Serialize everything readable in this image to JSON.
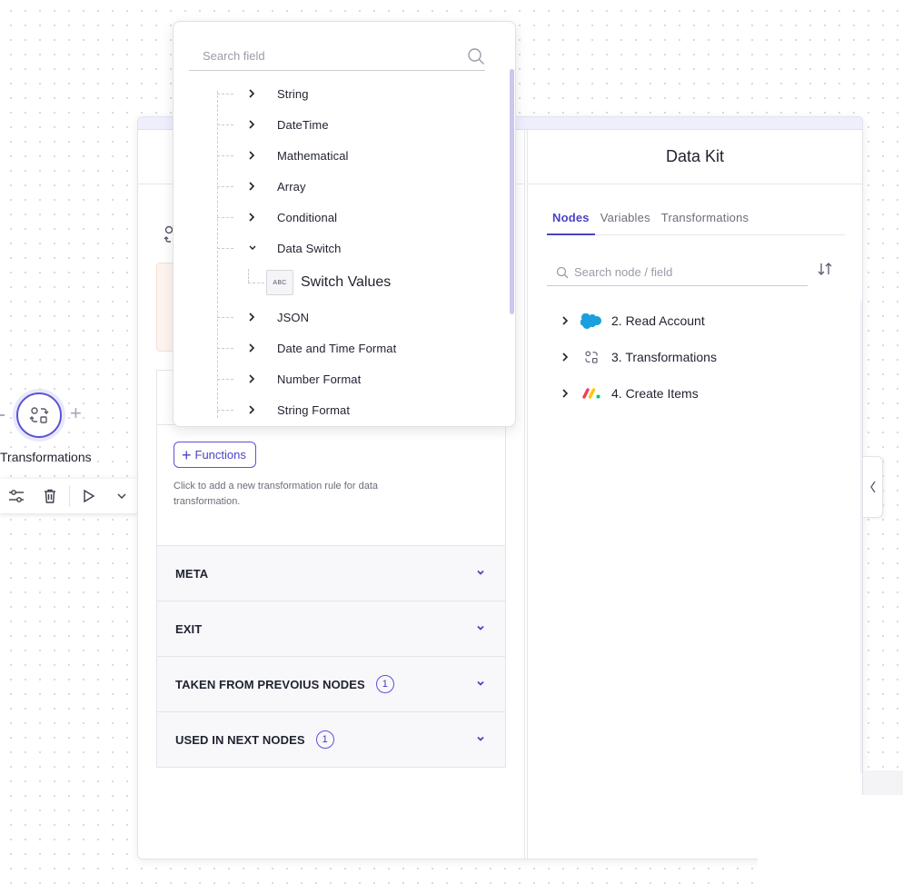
{
  "canvas": {
    "node_label": "Transformations",
    "toolbar_icons": [
      "sliders-icon",
      "trash-icon",
      "play-icon",
      "chevron-down-icon"
    ]
  },
  "functions_dropdown": {
    "search_placeholder": "Search field",
    "categories": [
      {
        "label": "String",
        "expanded": false
      },
      {
        "label": "DateTime",
        "expanded": false
      },
      {
        "label": "Mathematical",
        "expanded": false
      },
      {
        "label": "Array",
        "expanded": false
      },
      {
        "label": "Conditional",
        "expanded": false
      },
      {
        "label": "Data Switch",
        "expanded": true
      },
      {
        "label": "JSON",
        "expanded": false
      },
      {
        "label": "Date and Time Format",
        "expanded": false
      },
      {
        "label": "Number Format",
        "expanded": false
      },
      {
        "label": "String Format",
        "expanded": false
      }
    ],
    "data_switch_children": [
      {
        "badge": "ABC",
        "label": "Switch Values"
      }
    ]
  },
  "rules": {
    "functions_button": "Functions",
    "hint": "Click to add a new transformation rule for data transformation."
  },
  "sections": [
    {
      "label": "META",
      "count": null
    },
    {
      "label": "EXIT",
      "count": null
    },
    {
      "label": "TAKEN FROM PREVOIUS NODES",
      "count": "1"
    },
    {
      "label": "USED IN NEXT NODES",
      "count": "1"
    }
  ],
  "data_kit": {
    "title": "Data Kit",
    "tabs": [
      {
        "label": "Nodes",
        "active": true
      },
      {
        "label": "Variables",
        "active": false
      },
      {
        "label": "Transformations",
        "active": false
      }
    ],
    "search_placeholder": "Search node / field",
    "nodes": [
      {
        "label": "2. Read Account",
        "icon": "salesforce-icon"
      },
      {
        "label": "3. Transformations",
        "icon": "transformations-icon"
      },
      {
        "label": "4. Create Items",
        "icon": "monday-icon"
      }
    ]
  },
  "colors": {
    "accent": "#5b53d6",
    "accent_text": "#4a43c4",
    "salesforce": "#1ba0dd"
  }
}
